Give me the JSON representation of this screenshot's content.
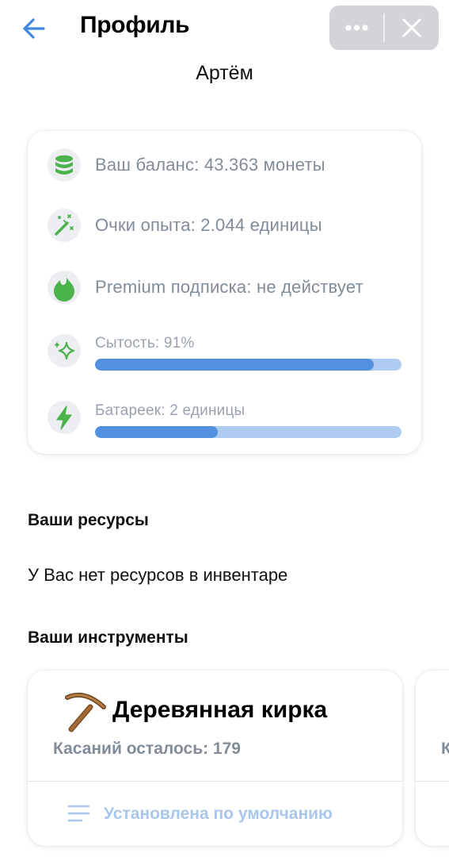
{
  "header": {
    "title": "Профиль",
    "back_icon": "arrow-left-icon",
    "more_icon": "more-horizontal-icon",
    "close_icon": "close-icon"
  },
  "user": {
    "name": "Артём"
  },
  "stats": {
    "balance": {
      "icon": "coins-stack-icon",
      "label": "Ваш баланс: 43.363 монеты"
    },
    "experience": {
      "icon": "magic-wand-icon",
      "label": "Очки опыта: 2.044 единицы"
    },
    "premium": {
      "icon": "drop-icon",
      "label": "Premium подписка: не действует"
    },
    "satiety": {
      "icon": "sparkles-icon",
      "label": "Сытость: 91%",
      "progress": 0.91
    },
    "batteries": {
      "icon": "lightning-icon",
      "label": "Батареек: 2 единицы",
      "progress": 0.4
    }
  },
  "resources": {
    "title": "Ваши ресурсы",
    "empty_text": "У Вас нет ресурсов в инвентаре"
  },
  "tools": {
    "title": "Ваши инструменты",
    "items": [
      {
        "icon": "pickaxe-icon",
        "name": "Деревянная кирка",
        "uses_label": "Касаний осталось: 179",
        "action_icon": "list-icon",
        "action_label": "Установлена по умолчанию"
      }
    ],
    "next_card_peek": "К"
  },
  "colors": {
    "accent": "#3f8ae0",
    "green_icon": "#4bb34b",
    "progress_fill": "#5390df",
    "progress_track": "#aecbf1",
    "secondary_text": "#818c99"
  }
}
